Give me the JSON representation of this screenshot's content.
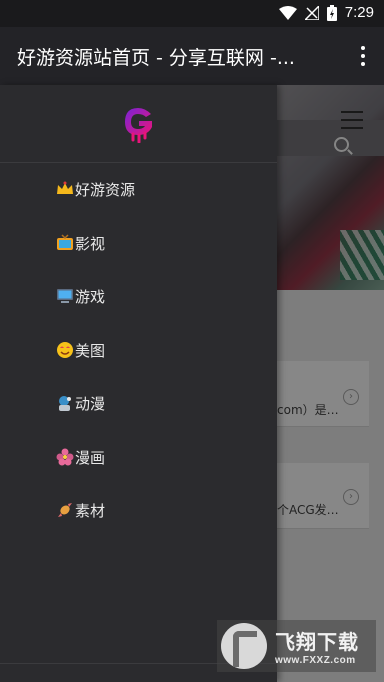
{
  "status_bar": {
    "time": "7:29"
  },
  "app_bar": {
    "title": "好游资源站首页 - 分享互联网 -..."
  },
  "drawer": {
    "items": [
      {
        "label": "好游资源",
        "icon": "crown-icon"
      },
      {
        "label": "影视",
        "icon": "tv-icon"
      },
      {
        "label": "游戏",
        "icon": "computer-icon"
      },
      {
        "label": "美图",
        "icon": "smiley-face-icon"
      },
      {
        "label": "动漫",
        "icon": "anime-character-icon"
      },
      {
        "label": "漫画",
        "icon": "flower-icon"
      },
      {
        "label": "素材",
        "icon": "candy-icon"
      }
    ]
  },
  "background": {
    "cards": [
      {
        "text": "com）是…"
      },
      {
        "text": "个ACG发…"
      }
    ]
  },
  "watermark": {
    "title": "飞翔下载",
    "url": "www.FXXZ.com"
  },
  "colors": {
    "drawer_bg": "#2b2b2e",
    "app_bar_bg": "#232327",
    "logo_pink": "#e8147a",
    "logo_purple": "#7a24d6"
  }
}
